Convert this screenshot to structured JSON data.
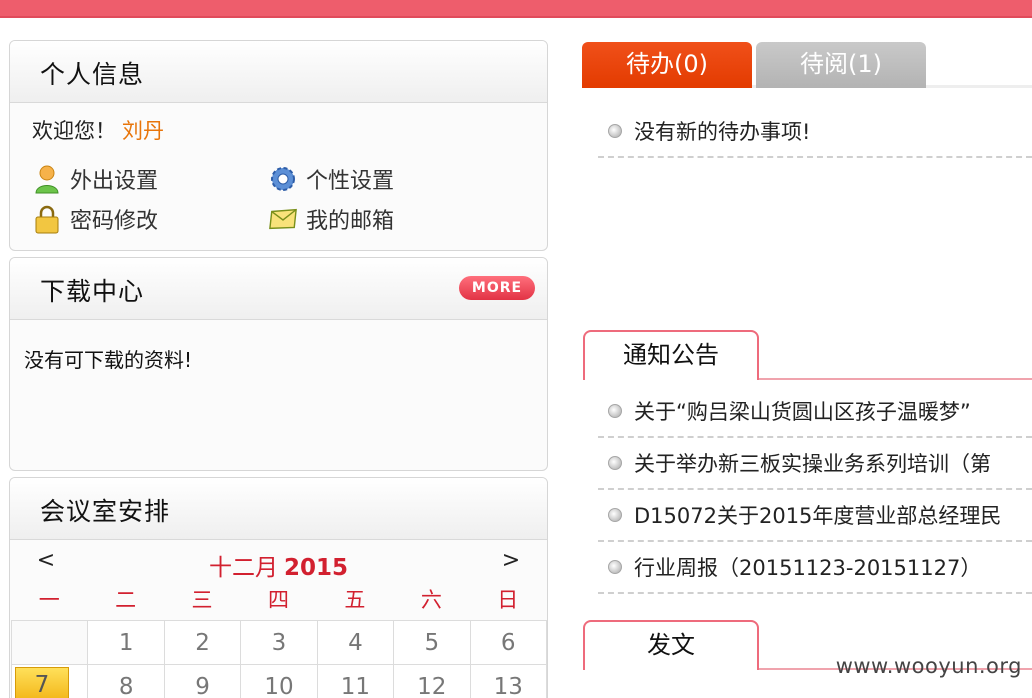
{
  "profile": {
    "title": "个人信息",
    "welcome_prefix": "欢迎您！",
    "user_name": "刘丹",
    "links": {
      "out_setting": "外出设置",
      "personal_setting": "个性设置",
      "password_change": "密码修改",
      "mailbox": "我的邮箱"
    }
  },
  "download": {
    "title": "下载中心",
    "more_label": "MORE",
    "empty_text": "没有可下载的资料!"
  },
  "meeting": {
    "title": "会议室安排",
    "prev": "<",
    "next": ">",
    "month": "十二月",
    "year": "2015",
    "weekdays": [
      "一",
      "二",
      "三",
      "四",
      "五",
      "六",
      "日"
    ],
    "row1": [
      "",
      "1",
      "2",
      "3",
      "4",
      "5",
      "6"
    ],
    "row2": [
      "7",
      "8",
      "9",
      "10",
      "11",
      "12",
      "13"
    ]
  },
  "tabs": {
    "todo": "待办(0)",
    "toread": "待阅(1)"
  },
  "todo_list": {
    "empty_text": "没有新的待办事项!"
  },
  "notice": {
    "title": "通知公告",
    "items": [
      "关于“购吕梁山货圆山区孩子温暖梦”",
      "关于举办新三板实操业务系列培训（第",
      "D15072关于2015年度营业部总经理民",
      "行业周报（20151123-20151127）"
    ]
  },
  "dispatch": {
    "title": "发文"
  },
  "watermark": "www.wooyun.org",
  "colors": {
    "topbar": "#ee5d6c",
    "active_tab": "#e33b00",
    "inactive_tab": "#b3b3b3",
    "accent_red": "#d2202f",
    "username": "#e8750a",
    "today": "#f3b71a"
  }
}
